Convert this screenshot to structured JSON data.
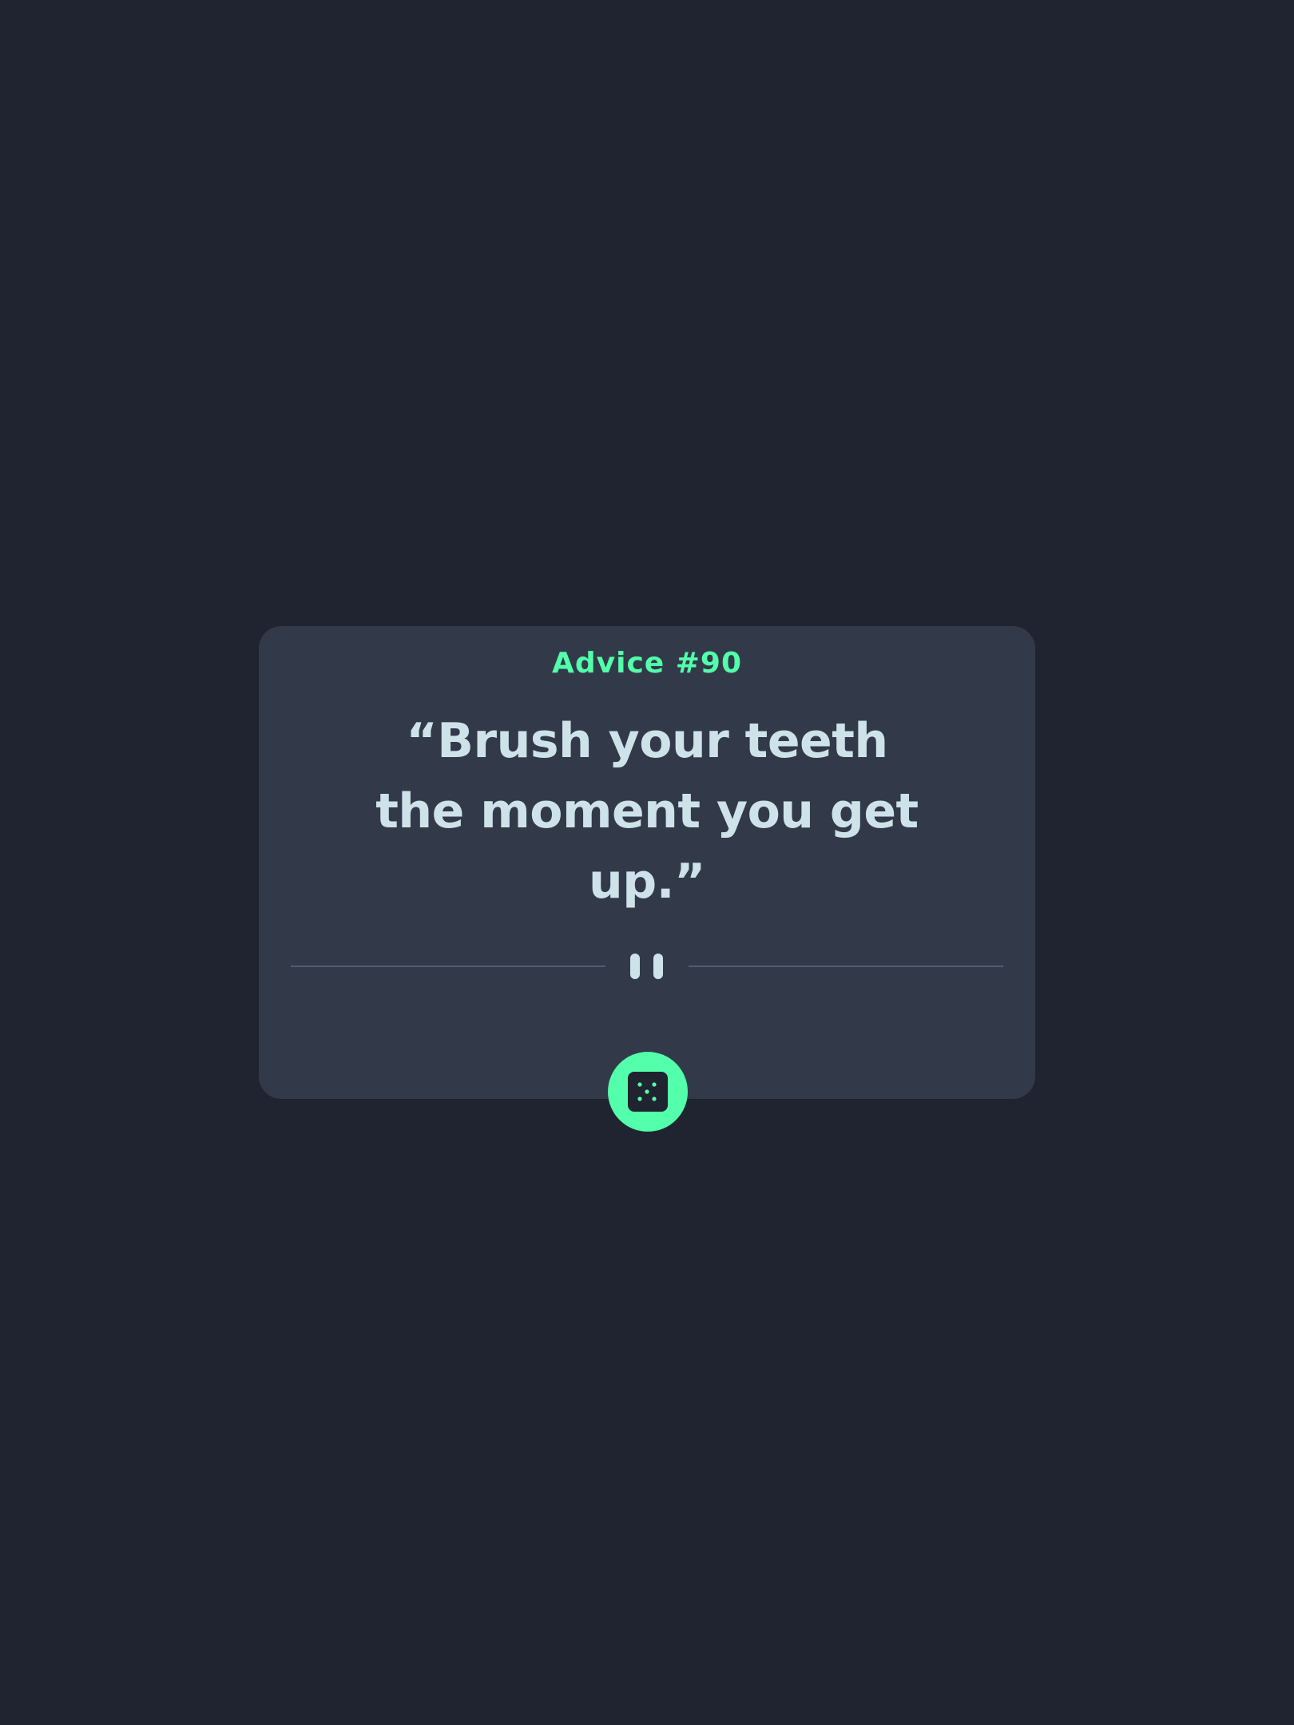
{
  "card": {
    "advice_label": "Advice #90",
    "quote": "“Brush your teeth the moment you get up.”"
  },
  "colors": {
    "background": "#1f2430",
    "card": "#323a49",
    "accent": "#53ffaa",
    "text": "#cee3e9",
    "divider": "#4f5d74"
  },
  "icons": {
    "divider_center": "pause-icon",
    "button": "dice-icon"
  }
}
